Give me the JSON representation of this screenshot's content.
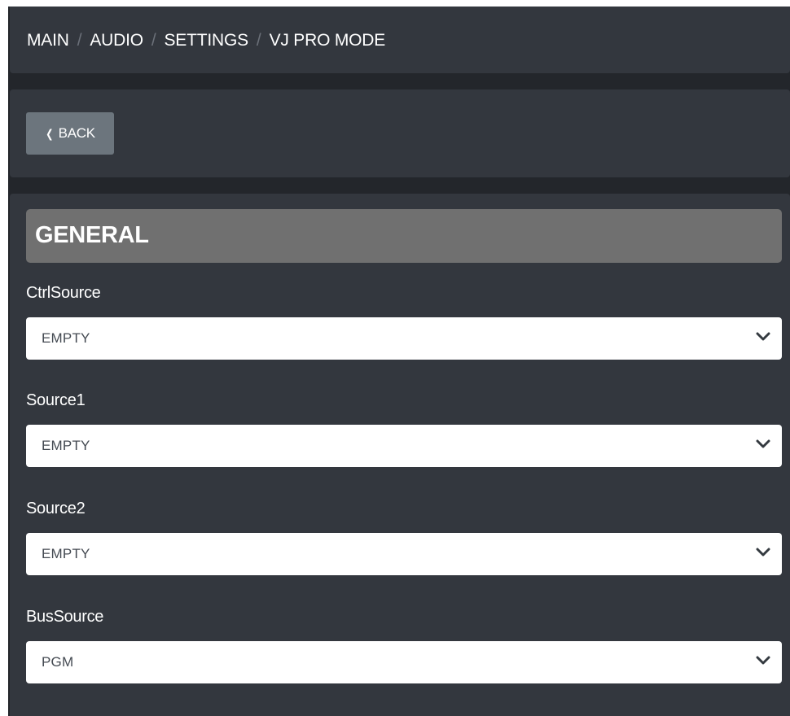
{
  "breadcrumb": {
    "items": [
      "MAIN",
      "AUDIO",
      "SETTINGS",
      "VJ PRO MODE"
    ],
    "separator": "/"
  },
  "back_button": {
    "icon": "chevron-left-icon",
    "label": "BACK"
  },
  "section": {
    "title": "GENERAL"
  },
  "fields": [
    {
      "label": "CtrlSource",
      "value": "EMPTY"
    },
    {
      "label": "Source1",
      "value": "EMPTY"
    },
    {
      "label": "Source2",
      "value": "EMPTY"
    },
    {
      "label": "BusSource",
      "value": "PGM"
    }
  ],
  "colors": {
    "background": "#23262b",
    "panel": "#33373e",
    "section_header": "#707070",
    "back_button": "#6c757d",
    "select_background": "#ffffff"
  }
}
